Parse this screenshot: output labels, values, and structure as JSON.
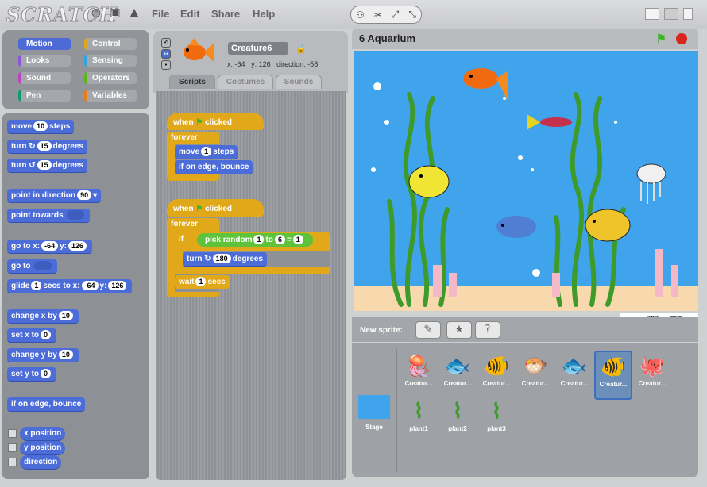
{
  "app": {
    "logo": "SCRATCH",
    "menus": [
      "File",
      "Edit",
      "Share",
      "Help"
    ]
  },
  "categories": [
    {
      "label": "Motion",
      "color": "#4a6cd4",
      "selected": true
    },
    {
      "label": "Control",
      "color": "#e1a91a"
    },
    {
      "label": "Looks",
      "color": "#8a55d7"
    },
    {
      "label": "Sensing",
      "color": "#2ca5e2"
    },
    {
      "label": "Sound",
      "color": "#bb42c3"
    },
    {
      "label": "Operators",
      "color": "#5cb712"
    },
    {
      "label": "Pen",
      "color": "#0e9a6c"
    },
    {
      "label": "Variables",
      "color": "#ee7d16"
    }
  ],
  "palette": {
    "move": {
      "pre": "move",
      "val": "10",
      "post": "steps"
    },
    "turn_cw": {
      "pre": "turn",
      "val": "15",
      "post": "degrees"
    },
    "turn_ccw": {
      "pre": "turn",
      "val": "15",
      "post": "degrees"
    },
    "point_dir": {
      "pre": "point in direction",
      "val": "90"
    },
    "point_towards": {
      "pre": "point towards"
    },
    "goto_xy": {
      "pre": "go to x:",
      "x": "-64",
      "mid": "y:",
      "y": "126"
    },
    "goto": {
      "pre": "go to"
    },
    "glide": {
      "pre": "glide",
      "secs": "1",
      "mid": "secs to x:",
      "x": "-64",
      "mid2": "y:",
      "y": "126"
    },
    "change_x": {
      "pre": "change x by",
      "val": "10"
    },
    "set_x": {
      "pre": "set x to",
      "val": "0"
    },
    "change_y": {
      "pre": "change y by",
      "val": "10"
    },
    "set_y": {
      "pre": "set y to",
      "val": "0"
    },
    "bounce": "if on edge, bounce",
    "reporters": [
      "x position",
      "y position",
      "direction"
    ]
  },
  "sprite": {
    "name": "Creature6",
    "x_label": "x:",
    "x": "-64",
    "y_label": "y:",
    "y": "126",
    "dir_label": "direction:",
    "direction": "-58"
  },
  "tabs": [
    "Scripts",
    "Costumes",
    "Sounds"
  ],
  "script1": {
    "hat": "when",
    "hat2": "clicked",
    "forever": "forever",
    "move_pre": "move",
    "move_val": "1",
    "move_post": "steps",
    "bounce": "if on edge, bounce"
  },
  "script2": {
    "hat": "when",
    "hat2": "clicked",
    "forever": "forever",
    "if": "if",
    "pick": "pick random",
    "from": "1",
    "to_label": "to",
    "to": "6",
    "eq": "=",
    "eq_val": "1",
    "turn_pre": "turn",
    "turn_val": "180",
    "turn_post": "degrees",
    "wait_pre": "wait",
    "wait_val": "1",
    "wait_post": "secs"
  },
  "stage": {
    "title": "6 Aquarium",
    "mouse_x_label": "x:",
    "mouse_x": "-737",
    "mouse_y_label": "y:",
    "mouse_y": "256"
  },
  "new_sprite_label": "New sprite:",
  "sprites_row1": [
    "Creatur...",
    "Creatur...",
    "Creatur...",
    "Creatur...",
    "Creatur...",
    "Creatur...",
    "Creatur..."
  ],
  "sprites_row2": [
    "plant1",
    "plant2",
    "plant3"
  ],
  "stage_thumb_label": "Stage"
}
